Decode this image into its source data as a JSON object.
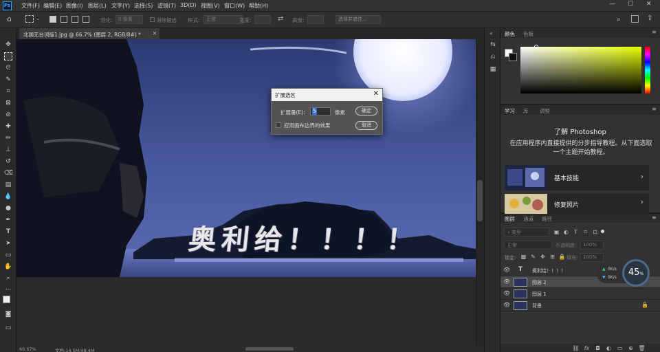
{
  "menubar": {
    "app_icon": "Ps",
    "items": [
      "文件(F)",
      "编辑(E)",
      "图像(I)",
      "图层(L)",
      "文字(Y)",
      "选择(S)",
      "滤镜(T)",
      "3D(D)",
      "视图(V)",
      "窗口(W)",
      "帮助(H)"
    ]
  },
  "optionsbar": {
    "feather_label": "羽化:",
    "feather_value": "0 像素",
    "antialias_label": "消除锯齿",
    "style_label": "样式:",
    "style_value": "正常",
    "width_label": "宽度:",
    "height_label": "高度:",
    "select_mask_button": "选择并遮住..."
  },
  "document": {
    "tab_title": "北国无台词版1.jpg @ 66.7% (图层 2, RGB/8#) *",
    "canvas_text": "奥利给！！！！",
    "zoom": "66.67%",
    "doc_info": "文档:14.5M/48.4M"
  },
  "dialog": {
    "title": "扩展选区",
    "expand_label": "扩展量(E):",
    "expand_value": "5",
    "unit": "像素",
    "ok_button": "确定",
    "cancel_button": "取消",
    "checkbox_label": "应用画布边界的效果",
    "checkbox_checked": false
  },
  "color_panel": {
    "tabs": [
      "颜色",
      "色板"
    ]
  },
  "learn_panel": {
    "tabs": [
      "学习",
      "库",
      "调整"
    ],
    "heading": "了解 Photoshop",
    "description": "在应用程序内直接提供的分步指导教程。从下面选取一个主题开始教程。",
    "cards": [
      {
        "label": "基本技能"
      },
      {
        "label": "修复照片"
      }
    ]
  },
  "layers_panel": {
    "tabs": [
      "图层",
      "通道",
      "路径"
    ],
    "filter_placeholder": "类型",
    "blend_mode": "正常",
    "opacity_label": "不透明度:",
    "opacity_value": "100%",
    "lock_label": "锁定:",
    "fill_label": "填充:",
    "fill_value": "100%",
    "layers": [
      {
        "name": "奥利给！！！！",
        "type": "text",
        "selected": false
      },
      {
        "name": "图层 2",
        "type": "pixel",
        "selected": true
      },
      {
        "name": "图层 1",
        "type": "pixel",
        "selected": false
      },
      {
        "name": "背景",
        "type": "pixel",
        "selected": false,
        "locked": true
      }
    ]
  },
  "net_widget": {
    "percent": "45",
    "unit": "%",
    "upload": "0K/s",
    "download": "0K/s"
  },
  "colors": {
    "ui_bg": "#282828",
    "panel_bg": "#2f2f2f",
    "accent": "#31a8ff",
    "selected_layer": "#4b4b4b"
  }
}
